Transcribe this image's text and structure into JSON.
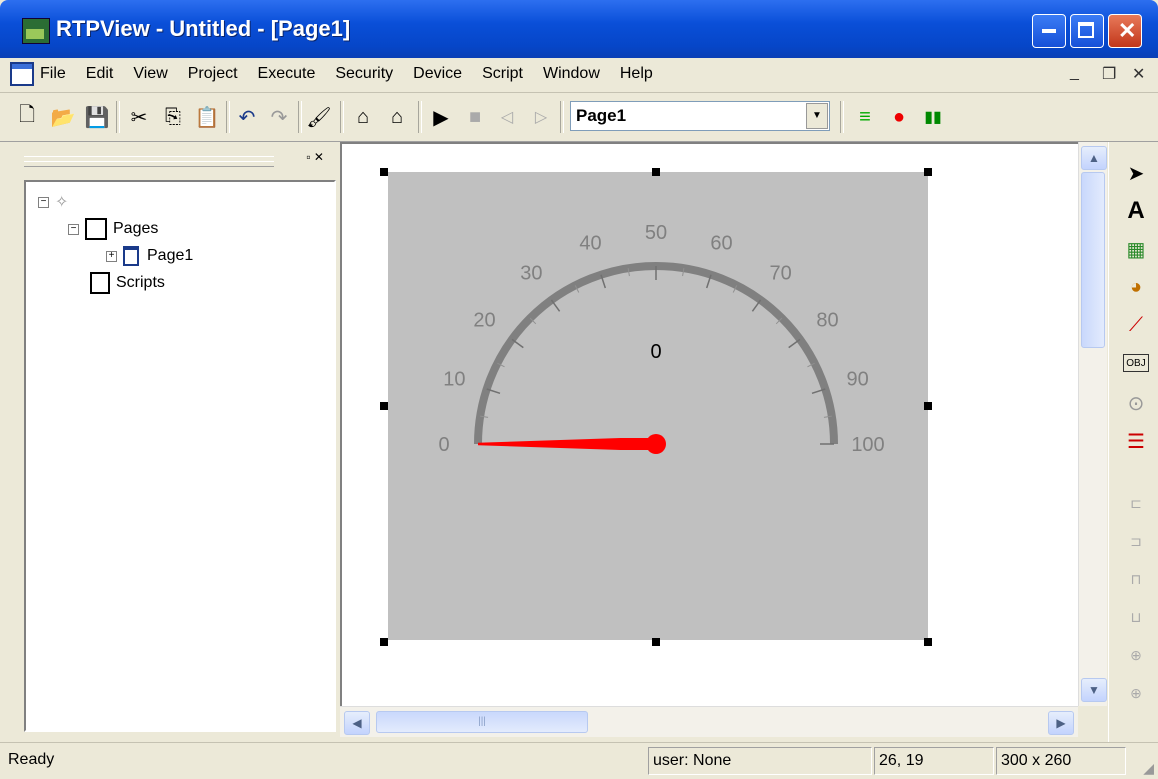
{
  "window": {
    "title": "RTPView  - Untitled - [Page1]"
  },
  "menu": {
    "items": [
      "File",
      "Edit",
      "View",
      "Project",
      "Execute",
      "Security",
      "Device",
      "Script",
      "Window",
      "Help"
    ]
  },
  "toolbar": {
    "page_combo_value": "Page1"
  },
  "tree": {
    "pages_label": "Pages",
    "page1_label": "Page1",
    "scripts_label": "Scripts"
  },
  "gauge": {
    "value": 0,
    "value_label": "0",
    "min": 0,
    "max": 100,
    "tick_labels": [
      "0",
      "10",
      "20",
      "30",
      "40",
      "50",
      "60",
      "70",
      "80",
      "90",
      "100"
    ],
    "face_color": "#c0c0c0",
    "arc_color": "#808080",
    "needle_color": "#ff0000"
  },
  "status": {
    "text": "Ready",
    "user": "user: None",
    "cursor": "26, 19",
    "size": "300 x 260"
  }
}
